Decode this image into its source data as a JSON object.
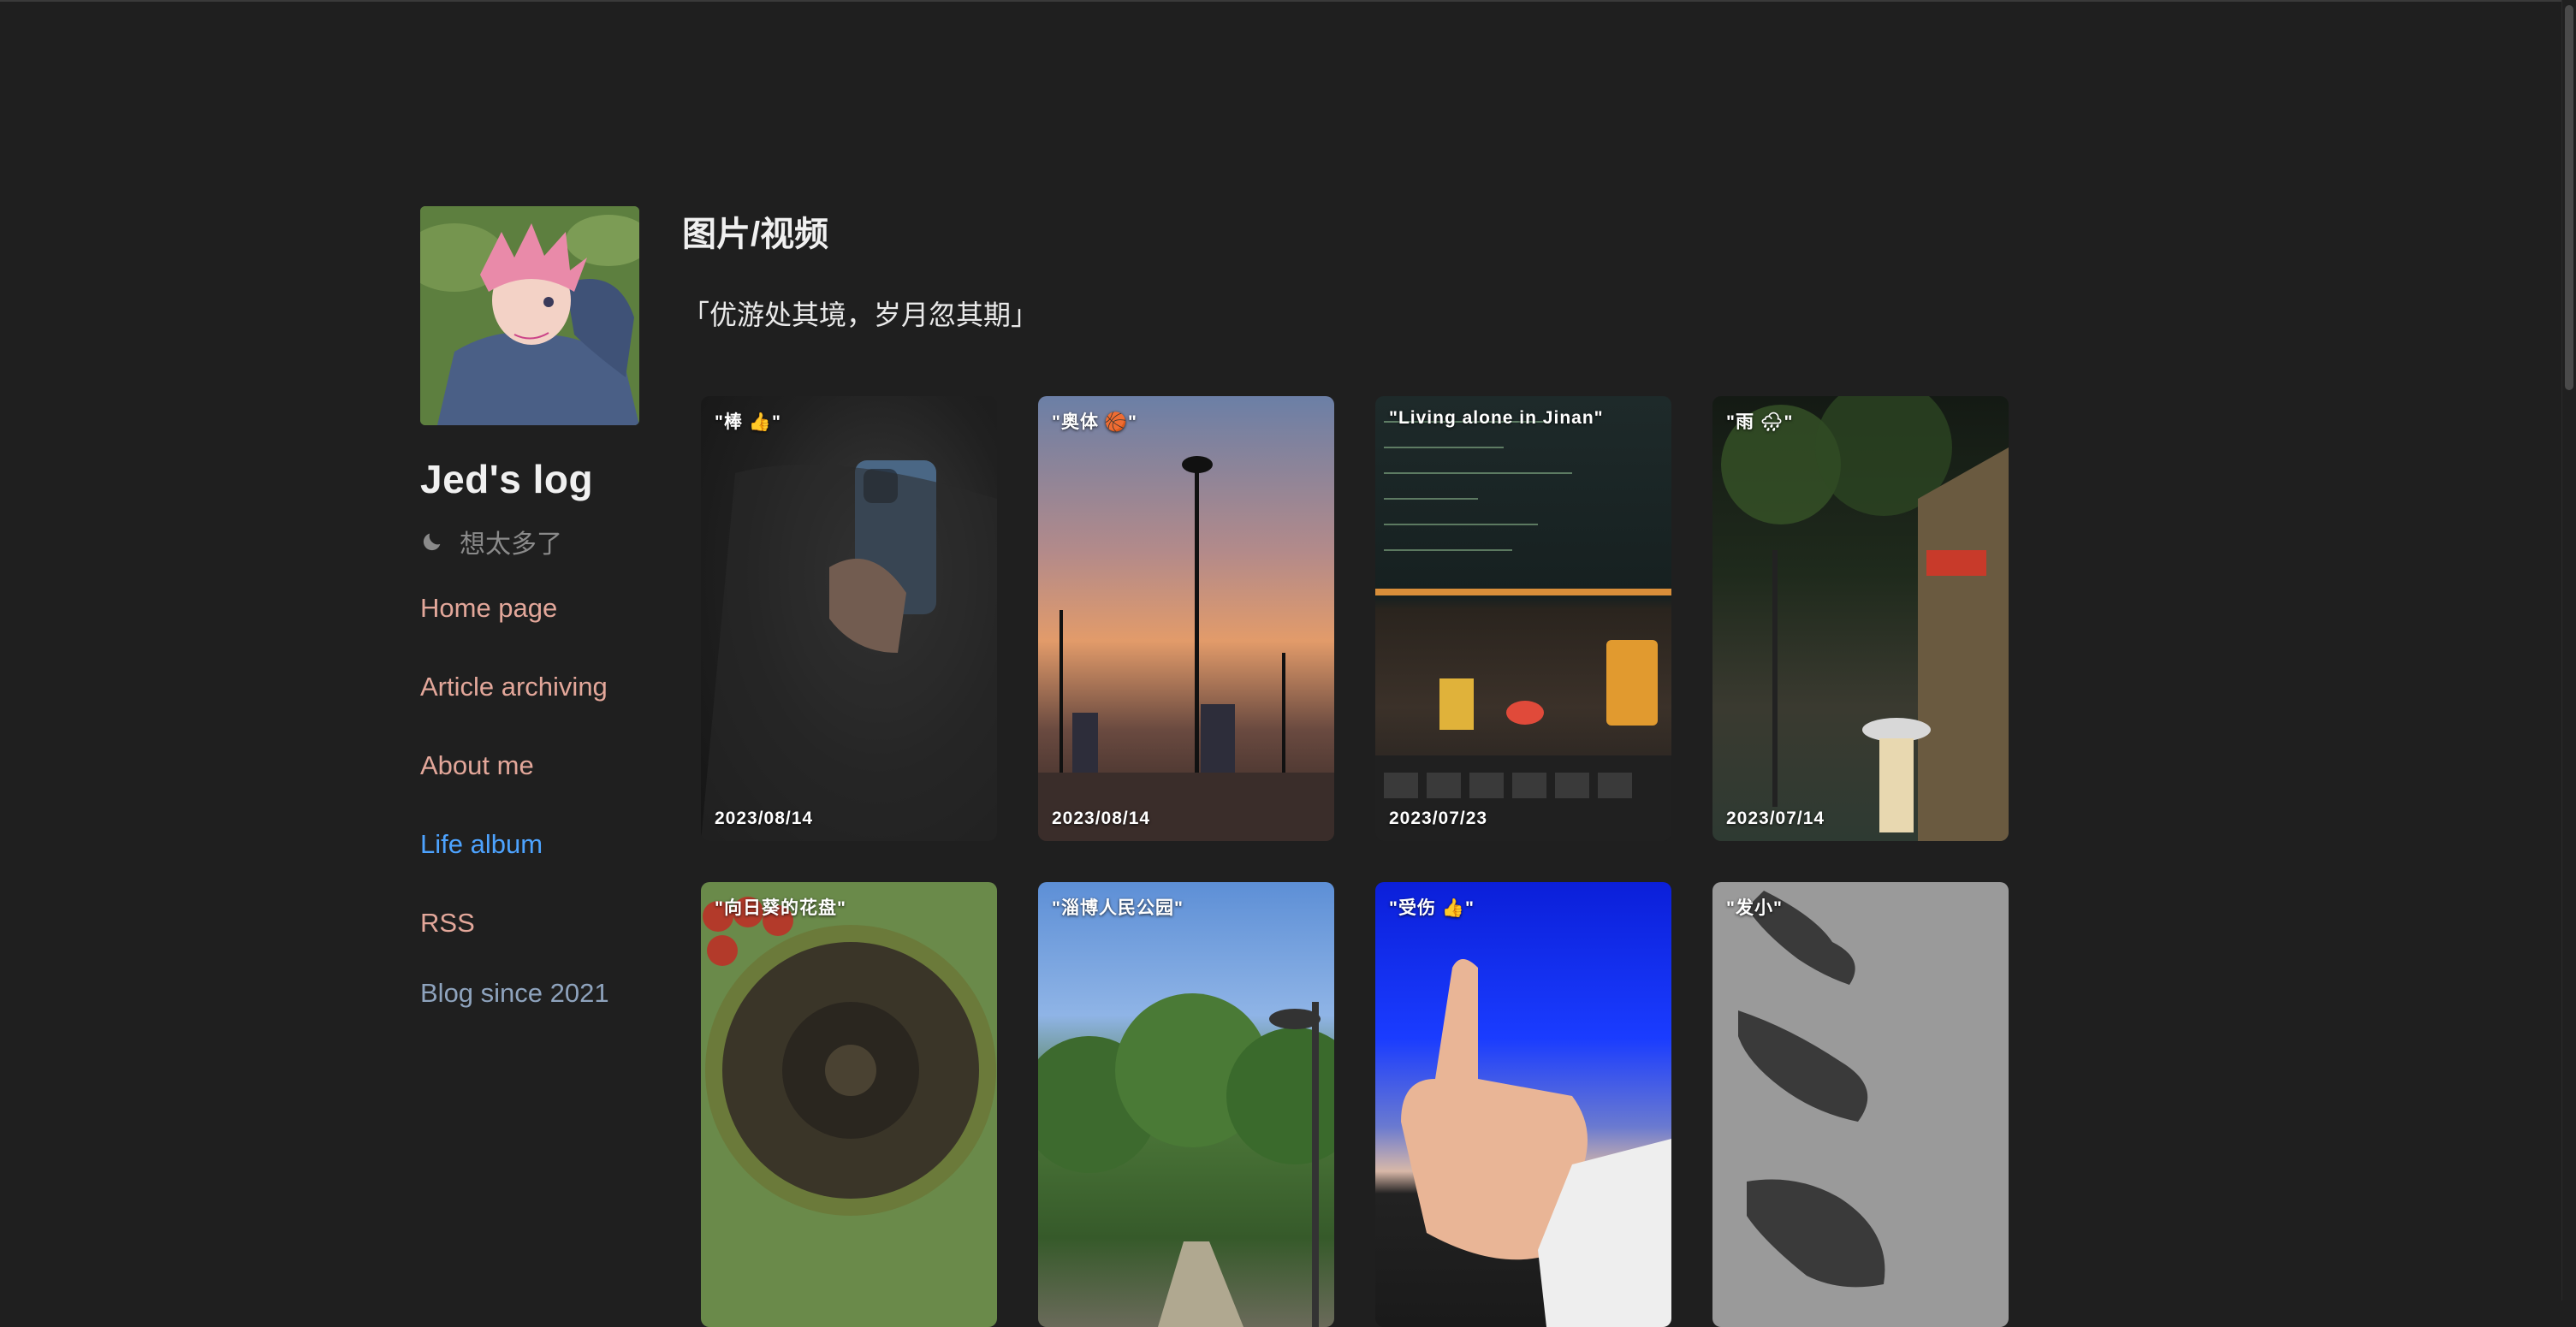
{
  "sidebar": {
    "site_title": "Jed's log",
    "tagline": "想太多了",
    "nav": [
      {
        "label": "Home page"
      },
      {
        "label": "Article archiving"
      },
      {
        "label": "About me"
      },
      {
        "label": "Life album"
      },
      {
        "label": "RSS"
      }
    ],
    "since": "Blog since 2021",
    "colors": {
      "nav": "#e3a79a",
      "active": "#4da3ff",
      "since": "#8ea3bd"
    }
  },
  "main": {
    "title": "图片/视频",
    "quote": "「优游处其境，岁月忽其期」"
  },
  "album": {
    "cards": [
      {
        "caption": "\"棒 👍\"",
        "date": "2023/08/14"
      },
      {
        "caption": "\"奥体 🏀\"",
        "date": "2023/08/14"
      },
      {
        "caption": "\"Living alone in Jinan\"",
        "date": "2023/07/23"
      },
      {
        "caption": "\"雨 🌧\"",
        "date": "2023/07/14"
      },
      {
        "caption": "\"向日葵的花盘\"",
        "date": ""
      },
      {
        "caption": "\"淄博人民公园\"",
        "date": ""
      },
      {
        "caption": "\"受伤 👍\"",
        "date": ""
      },
      {
        "caption": "\"发小\"",
        "date": ""
      }
    ]
  }
}
